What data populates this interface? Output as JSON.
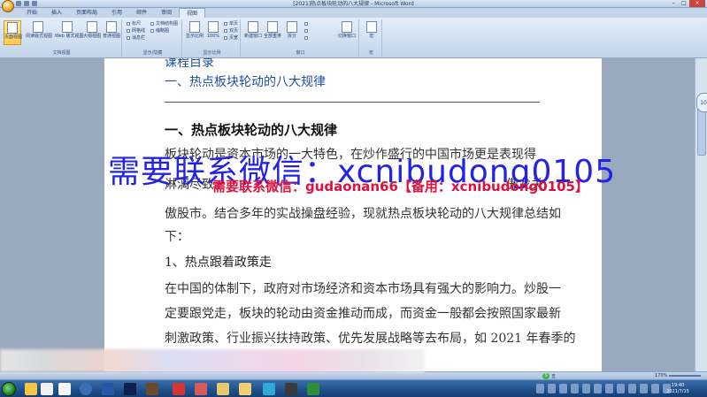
{
  "window": {
    "title": "[2021]热点板块轮动的八大规律 - Microsoft Word",
    "controls": [
      "–",
      "□",
      "×"
    ]
  },
  "tabs": [
    {
      "label": "开始"
    },
    {
      "label": "插入"
    },
    {
      "label": "页面布局"
    },
    {
      "label": "引用"
    },
    {
      "label": "邮件"
    },
    {
      "label": "审阅"
    },
    {
      "label": "视图"
    }
  ],
  "ribbon": {
    "views_group_label": "文档视图",
    "show_group_label": "显示/隐藏",
    "zoom_group_label": "显示比例",
    "window_group_label": "窗口",
    "macro_group_label": "宏",
    "buttons": {
      "print_layout": "页面视图",
      "reading": "阅读版式视图",
      "web": "Web 版式视图",
      "outline": "大纲视图",
      "draft": "普通视图",
      "zoom": "显示比例",
      "hundred": "100%",
      "one_page": "单页",
      "two_pages": "双页",
      "page_width": "页宽",
      "new_window": "新建窗口",
      "arrange_all": "全部重排",
      "split": "拆分",
      "switch_window": "切换窗口",
      "macros": "宏"
    },
    "checkboxes": {
      "ruler": "标尺",
      "gridlines": "网格线",
      "message_bar": "消息栏",
      "doc_map": "文档结构图",
      "thumbnails": "缩略图"
    }
  },
  "document": {
    "toc_heading": "课程目录",
    "toc_item": "一、热点板块轮动的八大规律",
    "heading1": "一、热点板块轮动的八大规律",
    "line1": "板块轮动是资本市场的一大特色，在炒作盛行的中国市场更是表现得",
    "line2": "淋漓尽致。",
    "line2_tail": "傲龙关",
    "line3": "傲股市。结合多年的实战操盘经验，现就热点板块轮动的八大规律总结如",
    "line4": "下：",
    "heading2": "1、热点跟着政策走",
    "line5": "在中国的体制下，政府对市场经济和资本市场具有强大的影响力。炒股一",
    "line6": "定要跟党走，板块的轮动由资金推动而成，而资金一般都会按照国家最新",
    "line7": "刺激政策、行业振兴扶持政策、优先发展战略等去布局，如 2021 年春季的"
  },
  "watermark": {
    "big": "需要联系微信：xcnibudong0105",
    "red": "需要联系微信：gudaonan66【备用：xcnibudong0105】"
  },
  "side_badge": "10",
  "status": {
    "zoom_level": "170%",
    "ime_label": "五"
  },
  "taskbar": {
    "time": "19:40",
    "date": "2021/7/15"
  }
}
